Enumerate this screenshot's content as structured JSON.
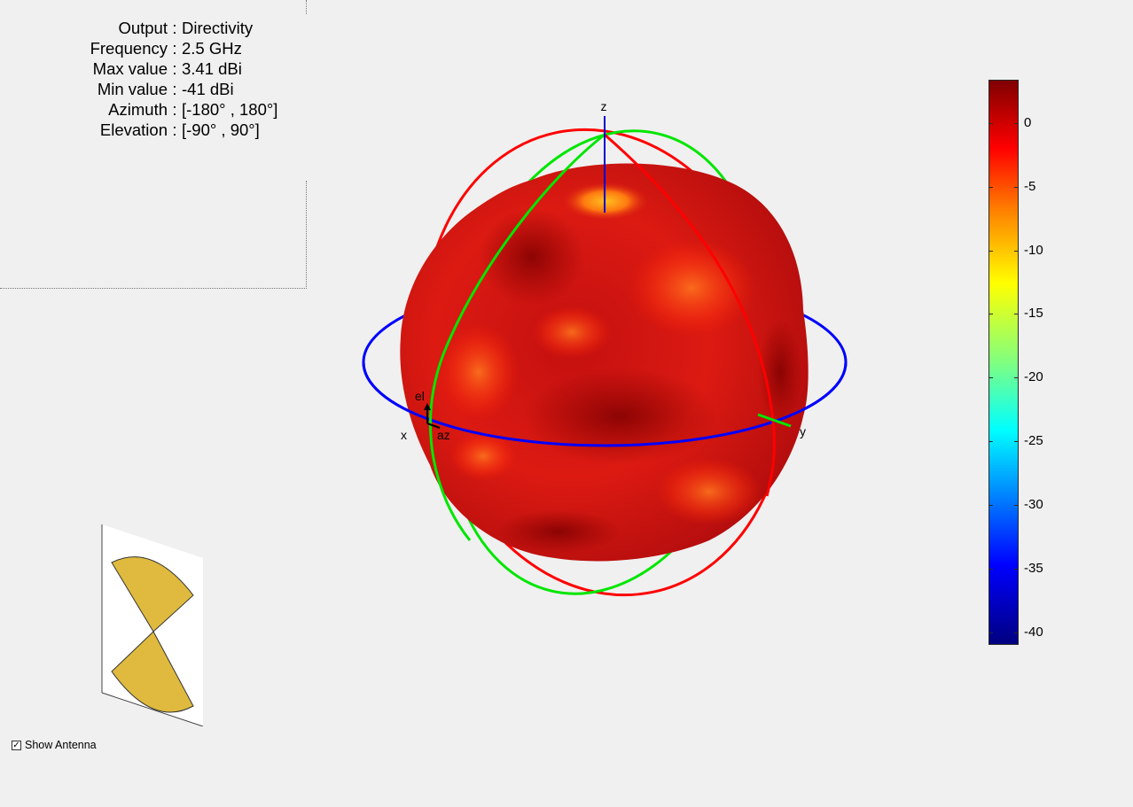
{
  "info": [
    {
      "label": "Output",
      "value": "Directivity"
    },
    {
      "label": "Frequency",
      "value": "2.5 GHz"
    },
    {
      "label": "Max value",
      "value": "3.41 dBi"
    },
    {
      "label": "Min value",
      "value": "-41 dBi"
    },
    {
      "label": "Azimuth",
      "value": "[-180° , 180°]"
    },
    {
      "label": "Elevation",
      "value": "[-90° , 90°]"
    }
  ],
  "axes": {
    "z_label": "z",
    "x_label": "x",
    "y_label": "y",
    "el_label": "el",
    "az_label": "az"
  },
  "colorbar": {
    "ticks": [
      "0",
      "-5",
      "-10",
      "-15",
      "-20",
      "-25",
      "-30",
      "-35",
      "-40"
    ],
    "max": 3.41,
    "min": -41
  },
  "show_antenna": {
    "label": "Show Antenna",
    "checked": true,
    "check_glyph": "✓"
  },
  "colors": {
    "azimuth_ring": "#0000ff",
    "elevation_ring_yz": "#00e600",
    "elevation_ring_xz": "#ff0000",
    "antenna_fill": "#dfba3e"
  }
}
